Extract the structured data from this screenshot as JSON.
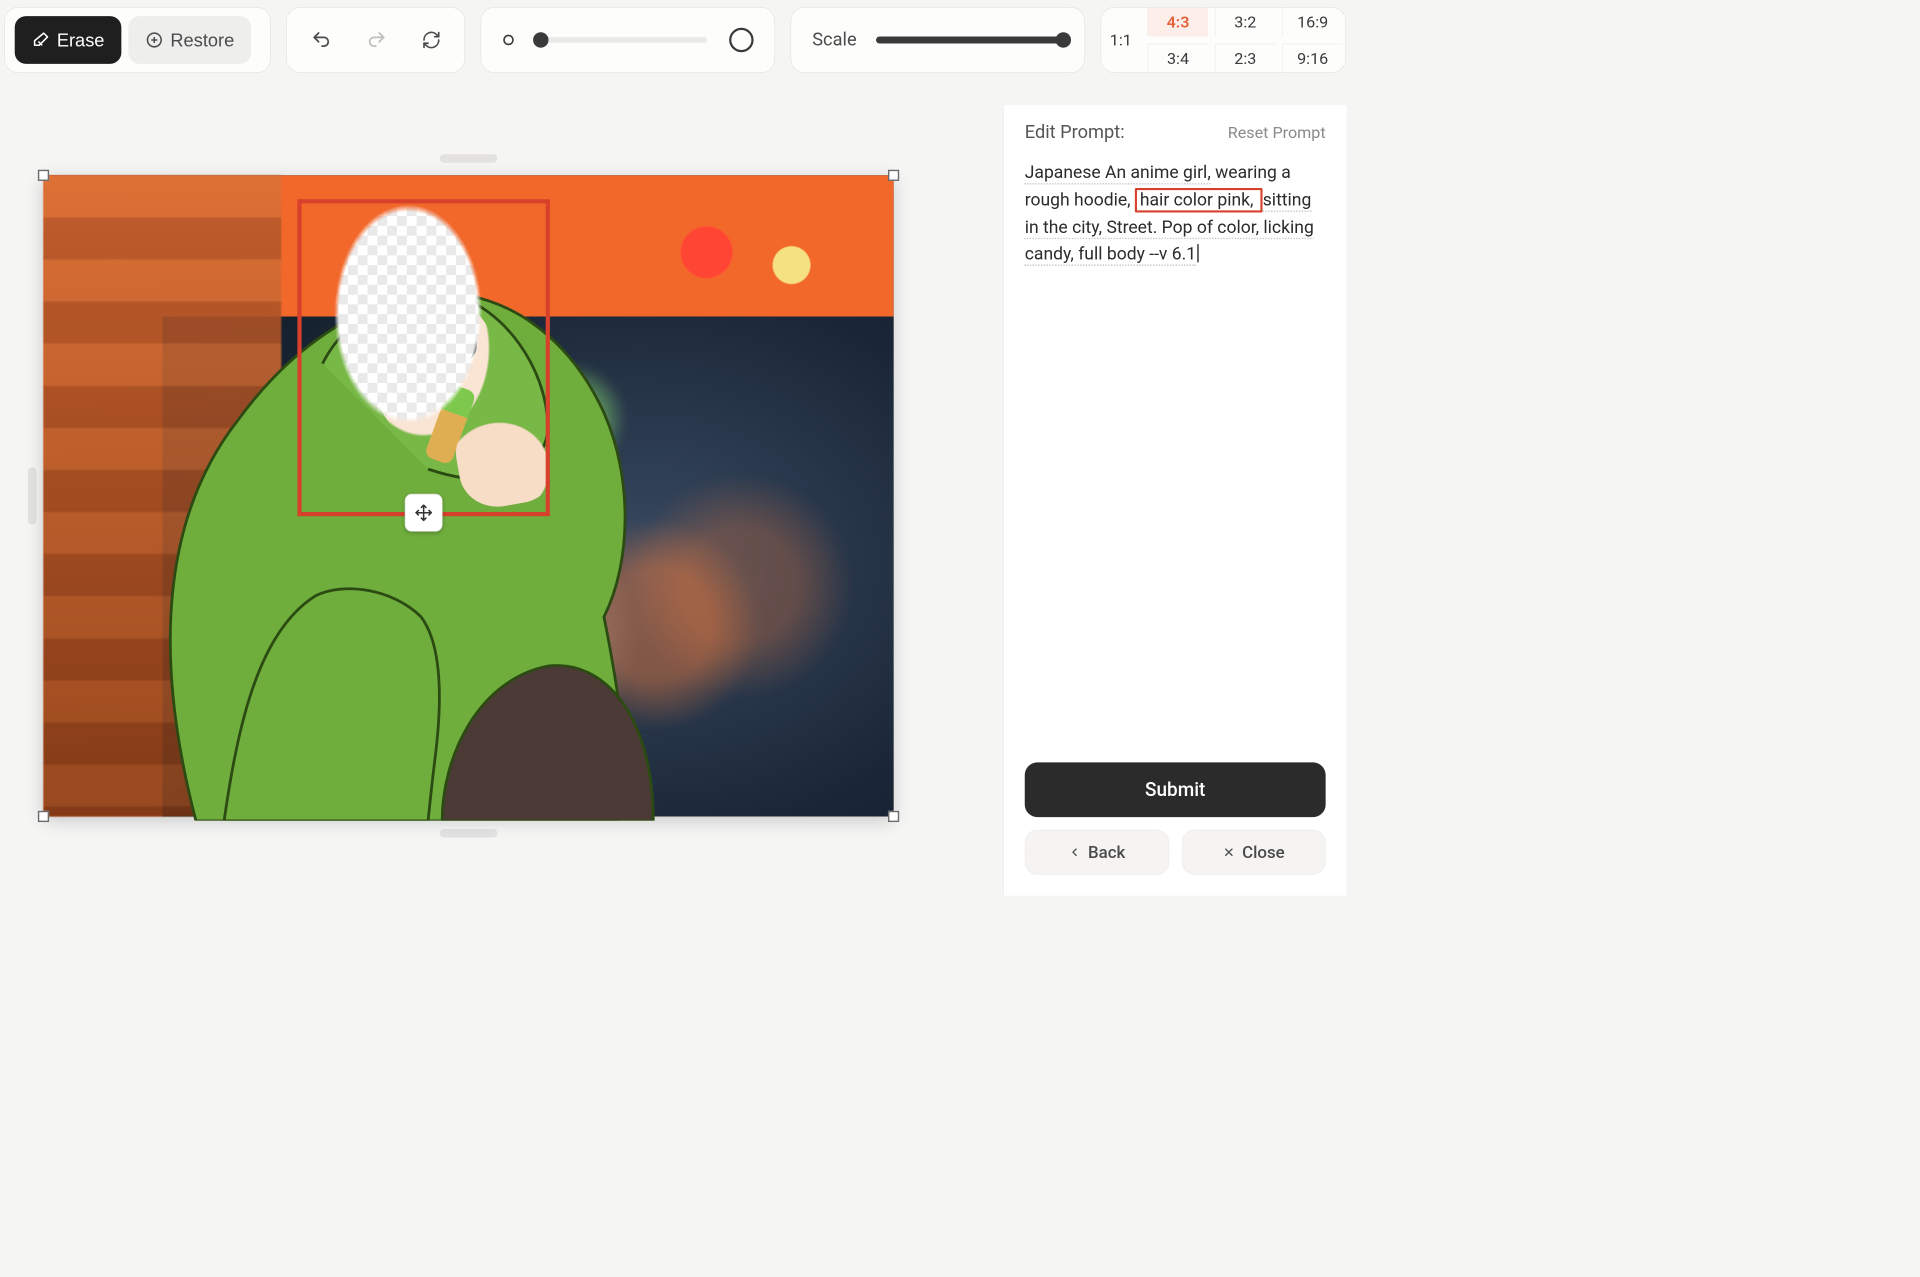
{
  "toolbar": {
    "erase_label": "Erase",
    "restore_label": "Restore",
    "scale_label": "Scale"
  },
  "aspect": {
    "one_one": "1:1",
    "r4_3": "4:3",
    "r3_2": "3:2",
    "r16_9": "16:9",
    "r3_4": "3:4",
    "r2_3": "2:3",
    "r9_16": "9:16",
    "selected": "4:3"
  },
  "rail": {
    "title": "Edit Prompt:",
    "reset": "Reset Prompt",
    "prompt": {
      "p1": "Japanese An anime girl,",
      "p2": " wearing a rough hoodie,",
      "hl": " hair color pink, ",
      "p3": "sitting in the city, Street. Pop of color, licking candy, full body --v 6.1"
    },
    "submit": "Submit",
    "back": "Back",
    "close": "Close"
  }
}
